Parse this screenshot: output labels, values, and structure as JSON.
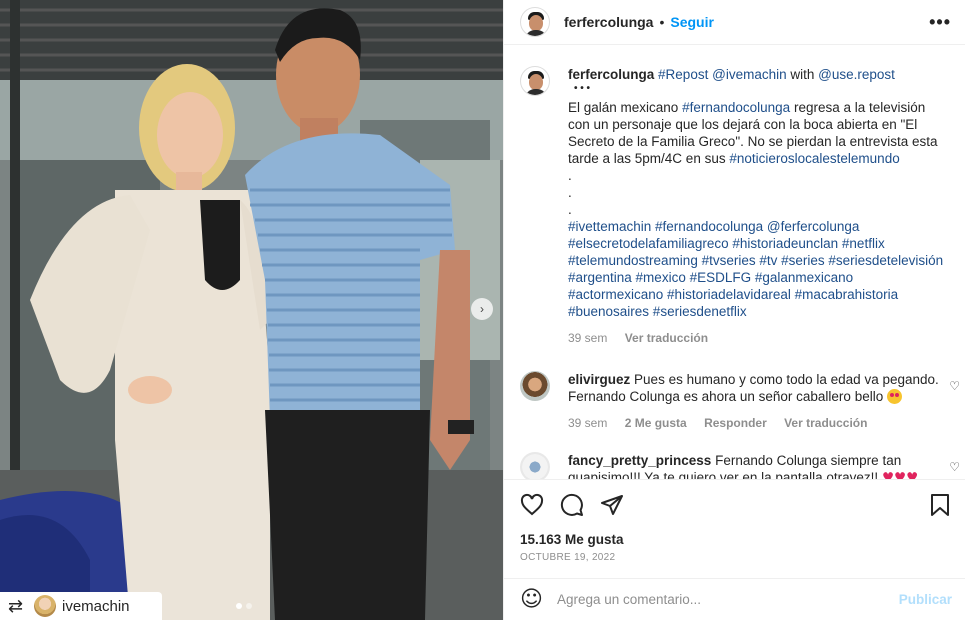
{
  "post": {
    "username": "ferfercolunga",
    "follow_label": "Seguir",
    "separator": "•",
    "more_label": "•••",
    "repost_tag_user": "ivemachin",
    "repost_icon": "repost-icon"
  },
  "caption": {
    "username": "ferfercolunga",
    "repost_hashtag": "#Repost",
    "repost_mention": "@ivemachin",
    "with_text": "with",
    "source_mention": "@use.repost",
    "bullets": "• • •",
    "text1": "El galán mexicano",
    "tag1": "#fernandocolunga",
    "text2": "regresa a la televisión con un personaje que los dejará con la boca abierta en \"El Secreto de la Familia Greco\". No se pierdan la entrevista esta tarde a las 5pm/4C en sus",
    "tag2": "#noticieroslocalestelemundo",
    "dot1": ".",
    "dot2": ".",
    "dot3": ".",
    "hashtags": "#ivettemachin #fernandocolunga @ferfercolunga #elsecretodelafamiliagreco #historiadeunclan #netflix #telemundostreaming #tvseries #tv #series #seriesdetelevisión #argentina #mexico #ESDLFG #galanmexicano #actormexicano #historiadelavidareal #macabrahistoria #buenosaires #seriesdenetflix",
    "time": "39 sem",
    "translate": "Ver traducción"
  },
  "comments": [
    {
      "username": "elivirguez",
      "text": "Pues es humano y como todo la edad va pegando. Fernando Colunga es ahora un señor caballero bello",
      "time": "39 sem",
      "likes": "2 Me gusta",
      "reply": "Responder",
      "translate": "Ver traducción"
    },
    {
      "username": "fancy_pretty_princess",
      "text": "Fernando Colunga siempre tan guapisimo!!! Ya te quiero ver en la pantalla otravez!!",
      "hearts": "♥♥♥"
    }
  ],
  "stats": {
    "likes": "15.163 Me gusta",
    "date": "OCTUBRE 19, 2022"
  },
  "composer": {
    "placeholder": "Agrega un comentario...",
    "post_label": "Publicar"
  },
  "colors": {
    "accent": "#0095f6",
    "hashtag": "#1f4f8a",
    "muted": "#8e8e8e"
  }
}
